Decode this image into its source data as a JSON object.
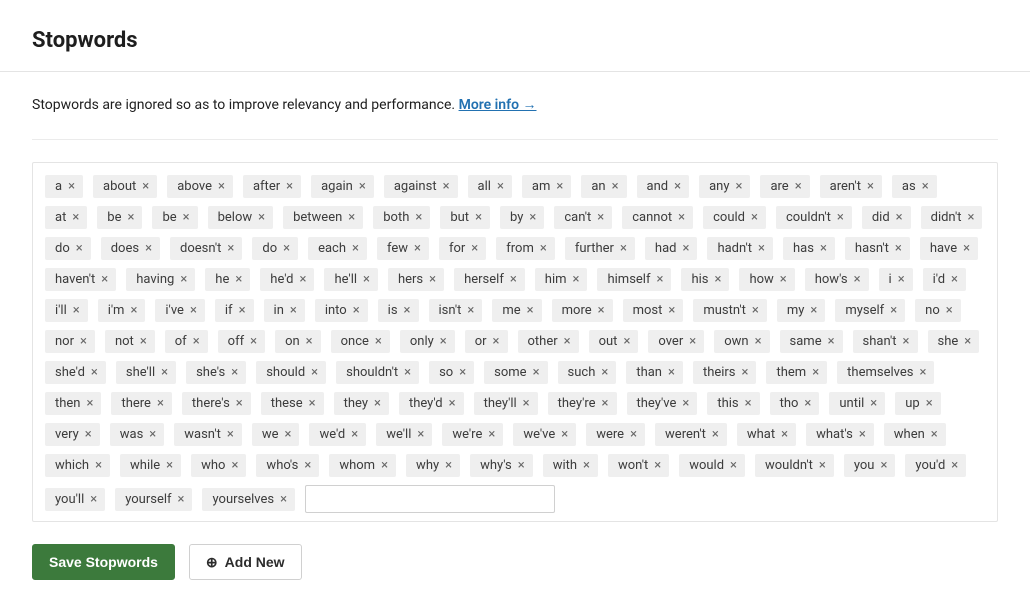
{
  "header": {
    "title": "Stopwords"
  },
  "description": {
    "text": "Stopwords are ignored so as to improve relevancy and performance. ",
    "link_text": "More info →"
  },
  "stopwords": [
    "a",
    "about",
    "above",
    "after",
    "again",
    "against",
    "all",
    "am",
    "an",
    "and",
    "any",
    "are",
    "aren't",
    "as",
    "at",
    "be",
    "be",
    "below",
    "between",
    "both",
    "but",
    "by",
    "can't",
    "cannot",
    "could",
    "couldn't",
    "did",
    "didn't",
    "do",
    "does",
    "doesn't",
    "do",
    "each",
    "few",
    "for",
    "from",
    "further",
    "had",
    "hadn't",
    "has",
    "hasn't",
    "have",
    "haven't",
    "having",
    "he",
    "he'd",
    "he'll",
    "hers",
    "herself",
    "him",
    "himself",
    "his",
    "how",
    "how's",
    "i",
    "i'd",
    "i'll",
    "i'm",
    "i've",
    "if",
    "in",
    "into",
    "is",
    "isn't",
    "me",
    "more",
    "most",
    "mustn't",
    "my",
    "myself",
    "no",
    "nor",
    "not",
    "of",
    "off",
    "on",
    "once",
    "only",
    "or",
    "other",
    "out",
    "over",
    "own",
    "same",
    "shan't",
    "she",
    "she'd",
    "she'll",
    "she's",
    "should",
    "shouldn't",
    "so",
    "some",
    "such",
    "than",
    "theirs",
    "them",
    "themselves",
    "then",
    "there",
    "there's",
    "these",
    "they",
    "they'd",
    "they'll",
    "they're",
    "they've",
    "this",
    "tho",
    "until",
    "up",
    "very",
    "was",
    "wasn't",
    "we",
    "we'd",
    "we'll",
    "we're",
    "we've",
    "were",
    "weren't",
    "what",
    "what's",
    "when",
    "which",
    "while",
    "who",
    "who's",
    "whom",
    "why",
    "why's",
    "with",
    "won't",
    "would",
    "wouldn't",
    "you",
    "you'd",
    "you'll",
    "yourself",
    "yourselves"
  ],
  "actions": {
    "save_label": "Save Stopwords",
    "add_new_label": "Add New"
  },
  "input": {
    "placeholder": ""
  }
}
